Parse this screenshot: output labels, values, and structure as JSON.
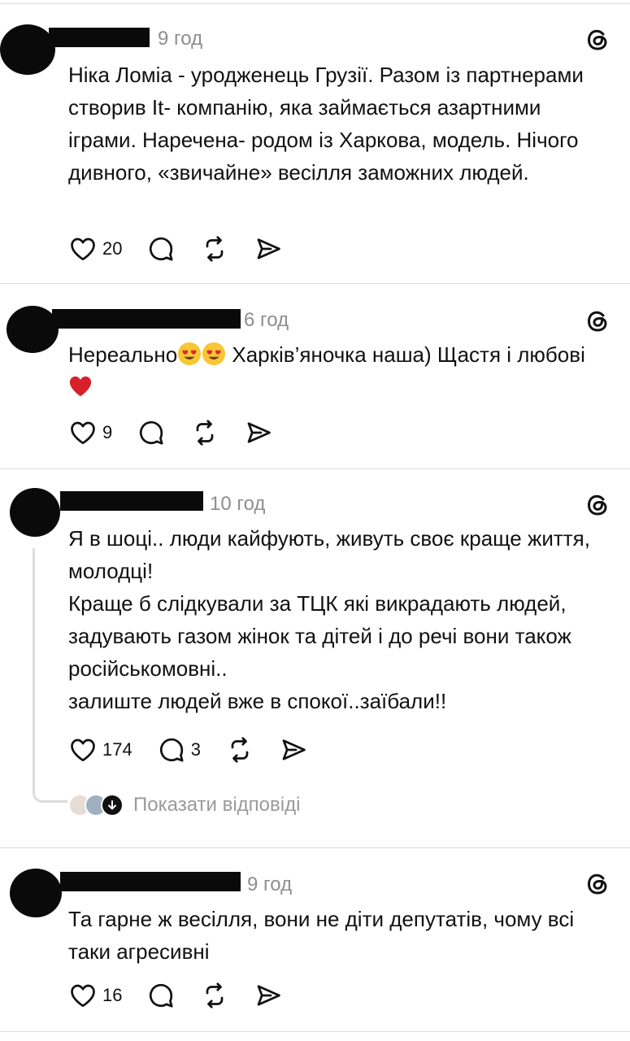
{
  "posts": [
    {
      "time": "9 год",
      "lines": [
        "Ніка Ломіа - уродженець Грузії. Разом із партнерами створив It- компанію, яка займається азартними іграми. Наречена- родом із Харкова, модель. Нічого дивного, «звичайне» весілля заможних людей."
      ],
      "likes": "20",
      "replies_count": ""
    },
    {
      "time": "6 год",
      "text_before": "Нереально",
      "text_after": " Харків’яночка наша) Щастя і любові ",
      "likes": "9",
      "replies_count": ""
    },
    {
      "time": "10 год",
      "lines": [
        "Я в шоці.. люди кайфують, живуть своє краще життя, молодці!",
        "Краще б слідкували за ТЦК які викрадають людей, задувають газом жінок та дітей і до речі вони також російськомовні..",
        "залиште людей вже в спокої..заїбали!!"
      ],
      "likes": "174",
      "replies_count": "3",
      "show_replies": "Показати відповіді"
    },
    {
      "time": "9 год",
      "lines": [
        "Та гарне ж весілля, вони не діти депутатів, чому всі таки агресивні"
      ],
      "likes": "16",
      "replies_count": ""
    }
  ],
  "icons": {
    "like": "heart-icon",
    "comment": "comment-icon",
    "repost": "repost-icon",
    "share": "share-icon",
    "brand": "threads-logo-icon",
    "emoji": "heart-eyes-emoji",
    "heart": "red-heart-emoji"
  },
  "colors": {
    "text": "#111111",
    "muted": "#8e8e8e",
    "divider": "#dcdcdc",
    "heart": "#d8202a"
  }
}
